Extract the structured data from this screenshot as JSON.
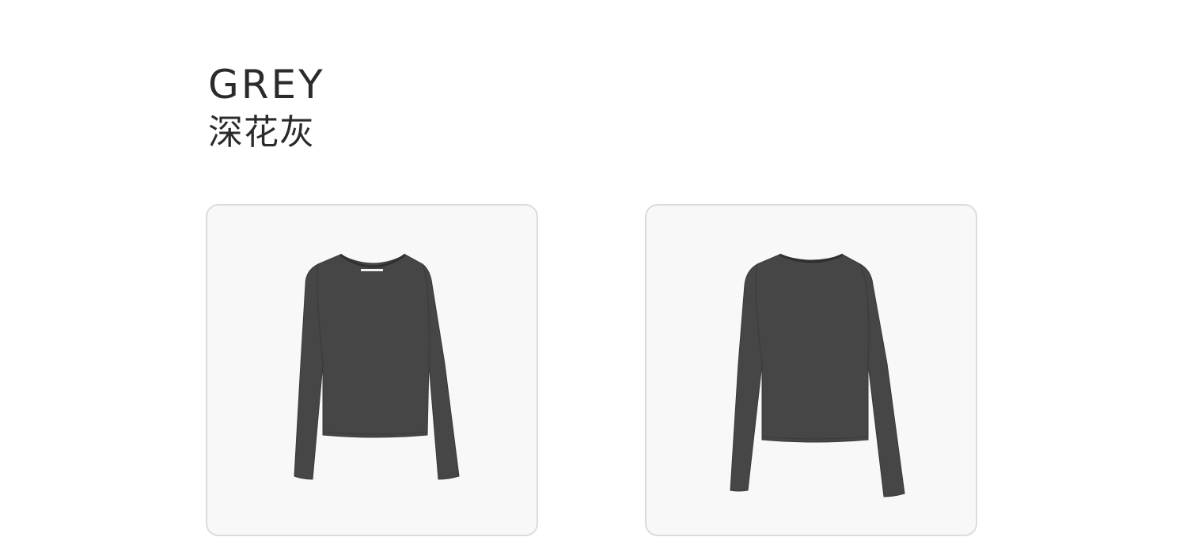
{
  "color_name_en": "GREY",
  "color_name_cn": "深花灰",
  "colors": {
    "garment": "#464646",
    "garment_shade": "#3a3a3a",
    "card_bg": "#f8f8f8",
    "card_border": "#dcdcdc"
  },
  "images": [
    {
      "view": "front",
      "icon": "grey-tshirt-front-image"
    },
    {
      "view": "back",
      "icon": "grey-tshirt-back-image"
    }
  ]
}
